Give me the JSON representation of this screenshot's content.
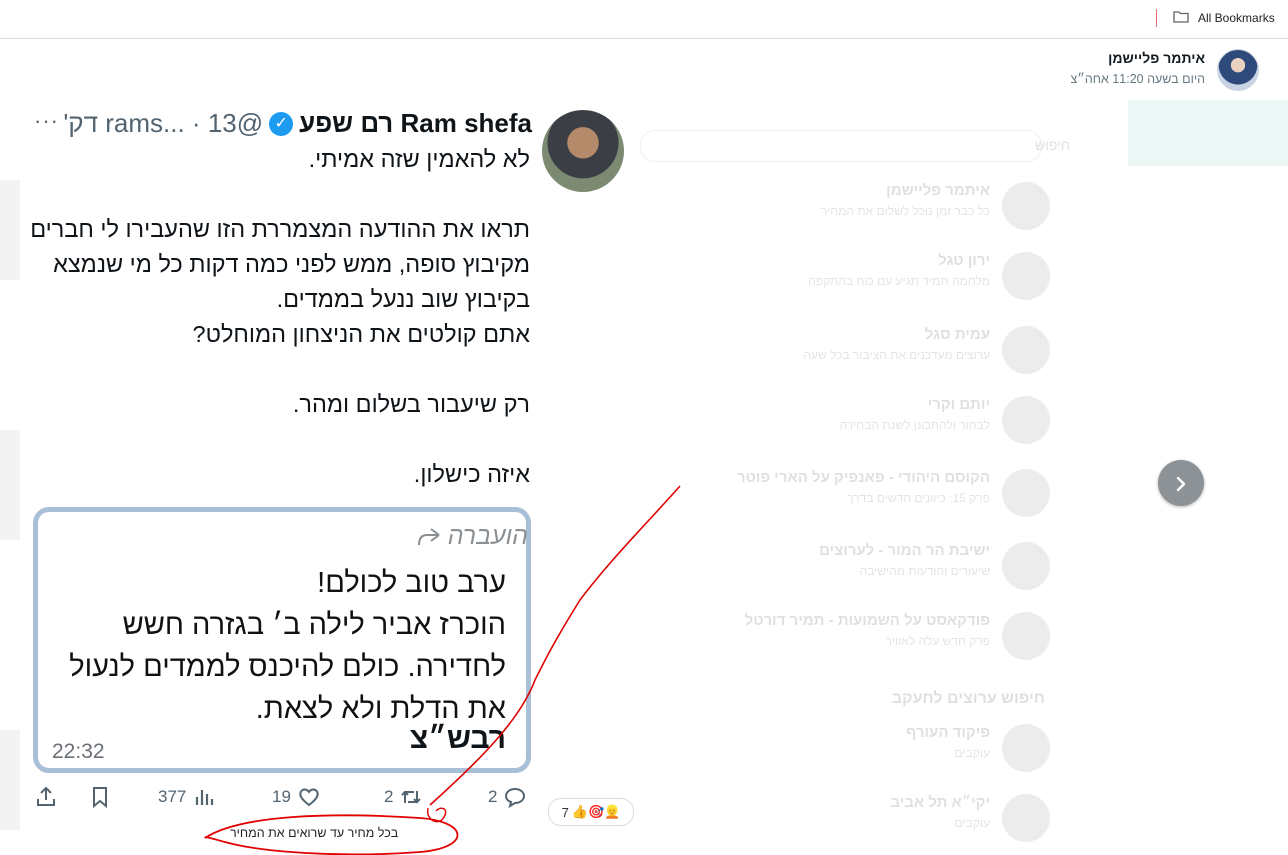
{
  "browser": {
    "bookmarks_label": "All Bookmarks"
  },
  "chat": {
    "contact_name": "איתמר פליישמן",
    "status_time": "היום בשעה 11:20 אחה״צ"
  },
  "tweet": {
    "author_name": "Ram shefa רם שפע",
    "handle_time": "@rams... · 13 דק'",
    "more": "···",
    "body": "לא להאמין שזה אמיתי.\n\nתראו את ההודעה המצמררת הזו שהעבירו לי חברים מקיבוץ סופה, ממש לפני כמה דקות כל מי שנמצא  בקיבוץ שוב ננעל בממדים.\nאתם קולטים את הניצחון המוחלט?\n\nרק שיעבור בשלום ומהר.\n\nאיזה כישלון.",
    "forward_label": "הועברה",
    "forward_text": "ערב טוב לכולם!\nהוכרז אביר לילה ב׳ בגזרה חשש לחדירה. כולם להיכנס לממדים לנעול את הדלת ולא לצאת.",
    "forward_signature": "רבש״צ",
    "forward_time": "22:32",
    "stats": {
      "views": "377",
      "likes": "19",
      "retweets": "2",
      "replies": "2"
    }
  },
  "reactions": {
    "count": "7",
    "emojis": "👍🎯👱"
  },
  "caption": "בכל מחיר עד שרואים את המחיר",
  "background": {
    "search_placeholder": "חיפוש",
    "items": [
      {
        "name": "איתמר פליישמן",
        "sub": "כל כבר זמן נוכל לשלום את המחיר"
      },
      {
        "name": "ירון טגל",
        "sub": "מלחמה תמיד תגיע עם כוח בהתקפה"
      },
      {
        "name": "עמית סגל",
        "sub": "ערוצים מעדכנים את הציבור בכל שעה"
      },
      {
        "name": "יותם וקרי",
        "sub": "לבחור ולהתכונן לשנת הבחירה"
      },
      {
        "name": "הקוסם היהודי - פאנפיק על הארי פוטר",
        "sub": "פרק 15: כיוונים חדשים בדרך"
      },
      {
        "name": "ישיבת הר המור - לערוצים",
        "sub": "שיעורים והודעות מהישיבה"
      },
      {
        "name": "פודקאסט על השמועות - תמיר דורטל",
        "sub": "פרק חדש עלה לאוויר"
      }
    ],
    "section_heading": "חיפוש ערוצים לחעקב",
    "suggested": [
      {
        "name": "פיקוד העורף",
        "sub": "עוקבים"
      },
      {
        "name": "יקי״א תל אביב",
        "sub": "עוקבים"
      }
    ]
  },
  "colors": {
    "verified": "#1d9bf0",
    "annotation": "#e00000",
    "forward_border": "#a9bfd6"
  }
}
